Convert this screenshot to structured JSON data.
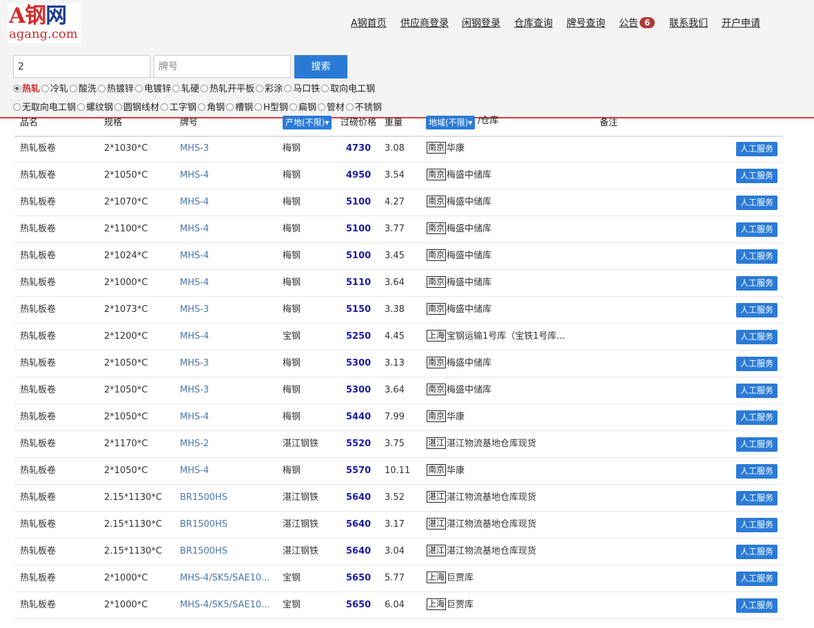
{
  "logo": {
    "brand_a": "A",
    "brand_rest": "钢",
    "brand_net": "网",
    "domain": "agang.com"
  },
  "nav": {
    "items": [
      "A钢首页",
      "供应商登录",
      "闲钢登录",
      "仓库查询",
      "牌号查询",
      "公告",
      "联系我们",
      "开户申请"
    ],
    "notice_count": "6"
  },
  "search": {
    "spec_value": "2",
    "grade_placeholder": "牌号",
    "button_label": "搜索"
  },
  "categories": {
    "row1": [
      "热轧",
      "冷轧",
      "酸洗",
      "热镀锌",
      "电镀锌",
      "轧硬",
      "热轧开平板",
      "彩涂",
      "马口铁",
      "取向电工钢"
    ],
    "row2": [
      "无取向电工钢",
      "螺纹钢",
      "圆钢线材",
      "工字钢",
      "角钢",
      "槽钢",
      "H型钢",
      "扁钢",
      "管材",
      "不锈钢"
    ],
    "selected": "热轧"
  },
  "table": {
    "headers": {
      "name": "品名",
      "spec": "规格",
      "grade": "牌号",
      "origin_filter": "产地(不限)",
      "price": "过磅价格",
      "weight": "重量",
      "region_filter": "地域(不限)",
      "warehouse": "/仓库",
      "remark": "备注"
    },
    "service_label": "人工服务",
    "rows": [
      {
        "name": "热轧板卷",
        "spec": "2*1030*C",
        "grade": "MHS-3",
        "origin": "梅钢",
        "price": "4730",
        "weight": "3.08",
        "city": "南京",
        "warehouse": "华康"
      },
      {
        "name": "热轧板卷",
        "spec": "2*1050*C",
        "grade": "MHS-4",
        "origin": "梅钢",
        "price": "4950",
        "weight": "3.54",
        "city": "南京",
        "warehouse": "梅盛中储库"
      },
      {
        "name": "热轧板卷",
        "spec": "2*1070*C",
        "grade": "MHS-4",
        "origin": "梅钢",
        "price": "5100",
        "weight": "4.27",
        "city": "南京",
        "warehouse": "梅盛中储库"
      },
      {
        "name": "热轧板卷",
        "spec": "2*1100*C",
        "grade": "MHS-4",
        "origin": "梅钢",
        "price": "5100",
        "weight": "3.77",
        "city": "南京",
        "warehouse": "梅盛中储库"
      },
      {
        "name": "热轧板卷",
        "spec": "2*1024*C",
        "grade": "MHS-4",
        "origin": "梅钢",
        "price": "5100",
        "weight": "3.45",
        "city": "南京",
        "warehouse": "梅盛中储库"
      },
      {
        "name": "热轧板卷",
        "spec": "2*1000*C",
        "grade": "MHS-4",
        "origin": "梅钢",
        "price": "5110",
        "weight": "3.64",
        "city": "南京",
        "warehouse": "梅盛中储库"
      },
      {
        "name": "热轧板卷",
        "spec": "2*1073*C",
        "grade": "MHS-3",
        "origin": "梅钢",
        "price": "5150",
        "weight": "3.38",
        "city": "南京",
        "warehouse": "梅盛中储库"
      },
      {
        "name": "热轧板卷",
        "spec": "2*1200*C",
        "grade": "MHS-4",
        "origin": "宝钢",
        "price": "5250",
        "weight": "4.45",
        "city": "上海",
        "warehouse": "宝钢运输1号库（宝铁1号库..."
      },
      {
        "name": "热轧板卷",
        "spec": "2*1050*C",
        "grade": "MHS-3",
        "origin": "梅钢",
        "price": "5300",
        "weight": "3.13",
        "city": "南京",
        "warehouse": "梅盛中储库"
      },
      {
        "name": "热轧板卷",
        "spec": "2*1050*C",
        "grade": "MHS-3",
        "origin": "梅钢",
        "price": "5300",
        "weight": "3.64",
        "city": "南京",
        "warehouse": "梅盛中储库"
      },
      {
        "name": "热轧板卷",
        "spec": "2*1050*C",
        "grade": "MHS-4",
        "origin": "梅钢",
        "price": "5440",
        "weight": "7.99",
        "city": "南京",
        "warehouse": "华康"
      },
      {
        "name": "热轧板卷",
        "spec": "2*1170*C",
        "grade": "MHS-2",
        "origin": "湛江钢铁",
        "price": "5520",
        "weight": "3.75",
        "city": "湛江",
        "warehouse": "湛江物流基地仓库现货"
      },
      {
        "name": "热轧板卷",
        "spec": "2*1050*C",
        "grade": "MHS-4",
        "origin": "梅钢",
        "price": "5570",
        "weight": "10.11",
        "city": "南京",
        "warehouse": "华康"
      },
      {
        "name": "热轧板卷",
        "spec": "2.15*1130*C",
        "grade": "BR1500HS",
        "origin": "湛江钢铁",
        "price": "5640",
        "weight": "3.52",
        "city": "湛江",
        "warehouse": "湛江物流基地仓库现货"
      },
      {
        "name": "热轧板卷",
        "spec": "2.15*1130*C",
        "grade": "BR1500HS",
        "origin": "湛江钢铁",
        "price": "5640",
        "weight": "3.17",
        "city": "湛江",
        "warehouse": "湛江物流基地仓库现货"
      },
      {
        "name": "热轧板卷",
        "spec": "2.15*1130*C",
        "grade": "BR1500HS",
        "origin": "湛江钢铁",
        "price": "5640",
        "weight": "3.04",
        "city": "湛江",
        "warehouse": "湛江物流基地仓库现货"
      },
      {
        "name": "热轧板卷",
        "spec": "2*1000*C",
        "grade": "MHS-4/SK5/SAE10...",
        "origin": "宝钢",
        "price": "5650",
        "weight": "5.77",
        "city": "上海",
        "warehouse": "巨贾库"
      },
      {
        "name": "热轧板卷",
        "spec": "2*1000*C",
        "grade": "MHS-4/SK5/SAE10...",
        "origin": "宝钢",
        "price": "5650",
        "weight": "6.04",
        "city": "上海",
        "warehouse": "巨贾库"
      }
    ]
  }
}
